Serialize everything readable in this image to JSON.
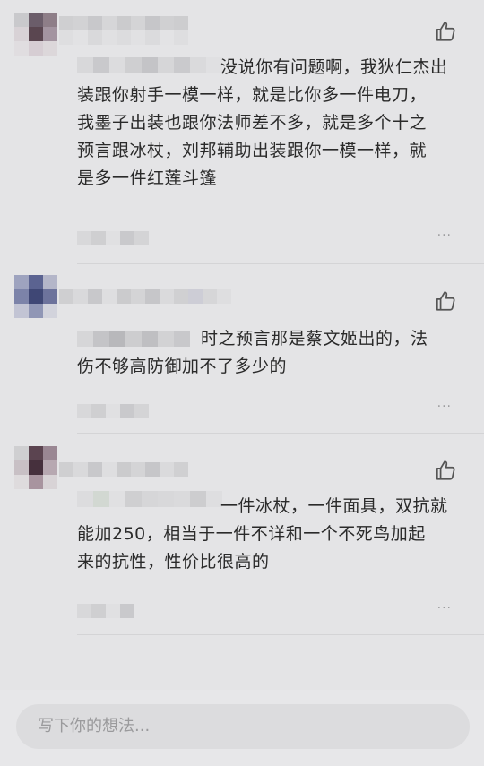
{
  "comments": [
    {
      "text_lines": [
        "没说你有问题啊，我狄仁杰出",
        "装跟你射手一模一样，就是比你多一件电刀，",
        "我墨子出装也跟你法师差不多，就是多个十之",
        "预言跟冰杖，刘邦辅助出装跟你一模一样，就",
        "是多一件红莲斗篷"
      ],
      "more": "···"
    },
    {
      "text_lines": [
        "时之预言那是蔡文姬出的，法",
        "伤不够高防御加不了多少的"
      ],
      "more": "···"
    },
    {
      "text_lines": [
        "一件冰杖，一件面具，双抗就",
        "能加250，相当于一件不详和一个不死鸟加起",
        "来的抗性，性价比很高的"
      ],
      "more": "···"
    }
  ],
  "input": {
    "placeholder": "写下你的想法..."
  },
  "colors": {
    "background": "#e4e4e6",
    "text": "#2a2a2a",
    "muted": "#9c9c9e"
  },
  "icons": {
    "like": "thumbs-up-icon",
    "more": "more-dots-icon"
  }
}
